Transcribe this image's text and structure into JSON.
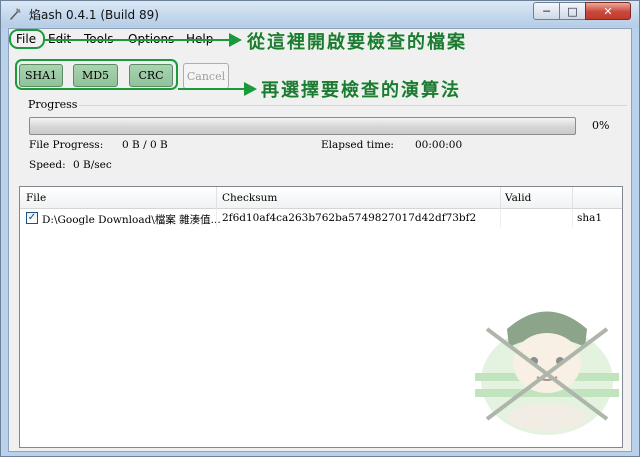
{
  "window": {
    "title": "焰ash 0.4.1 (Build 89)",
    "minimize_glyph": "─",
    "maximize_glyph": "□",
    "close_glyph": "✕"
  },
  "menu": {
    "file": "File",
    "edit": "Edit",
    "tools": "Tools",
    "options": "Options",
    "help": "Help"
  },
  "toolbar": {
    "sha1": "SHA1",
    "md5": "MD5",
    "crc": "CRC",
    "cancel": "Cancel"
  },
  "annotations": {
    "file_menu_note": "從這裡開啟要檢查的檔案",
    "algorithm_note": "再選擇要檢查的演算法"
  },
  "progress": {
    "label": "Progress",
    "percent_text": "0%",
    "fraction": 0,
    "file_progress_label": "File Progress:",
    "file_progress_value": "0 B / 0 B",
    "elapsed_label": "Elapsed time:",
    "elapsed_value": "00:00:00",
    "speed_label": "Speed:",
    "speed_value": "0 B/sec"
  },
  "list": {
    "columns": [
      "File",
      "Checksum",
      "Valid",
      ""
    ],
    "rows": [
      {
        "checked": true,
        "file": "D:\\Google Download\\檔案 雜湊值...",
        "checksum": "2f6d10af4ca263b762ba5749827017d42df73bf2",
        "valid": "",
        "algorithm": "sha1"
      }
    ]
  },
  "colors": {
    "annotation_green": "#1a9a3a",
    "progress_green": "#2fa52f",
    "titlebar_blue": "#c3d7ec"
  }
}
